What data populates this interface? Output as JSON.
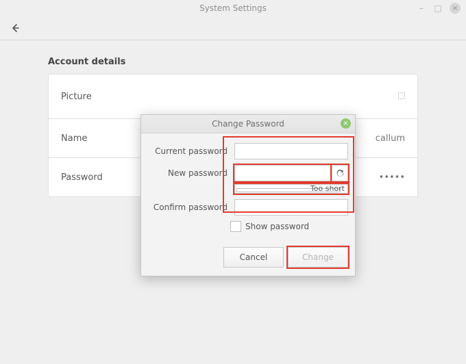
{
  "window": {
    "title": "System Settings"
  },
  "section_heading": "Account details",
  "details": {
    "picture_label": "Picture",
    "name_label": "Name",
    "name_value": "callum",
    "password_label": "Password",
    "password_mask": "•••••"
  },
  "dialog": {
    "title": "Change Password",
    "current_label": "Current password",
    "new_label": "New password",
    "confirm_label": "Confirm password",
    "strength_label": "Too short",
    "show_password_label": "Show password",
    "cancel_label": "Cancel",
    "change_label": "Change"
  }
}
